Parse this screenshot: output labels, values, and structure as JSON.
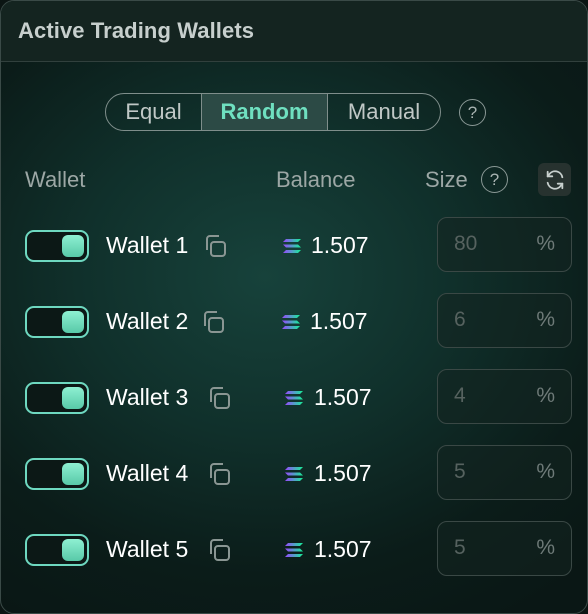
{
  "header": {
    "title": "Active Trading Wallets"
  },
  "mode_selector": {
    "options": [
      "Equal",
      "Random",
      "Manual"
    ],
    "selected": "Random",
    "help_symbol": "?"
  },
  "columns": {
    "wallet": "Wallet",
    "balance": "Balance",
    "size": "Size",
    "size_help_symbol": "?"
  },
  "colors": {
    "accent": "#6fe0c0",
    "toggle_border": "#6ed8c0",
    "text": "#ffffff",
    "muted": "#9ca7a5"
  },
  "wallets": [
    {
      "name": "Wallet 1",
      "enabled": true,
      "balance": "1.507",
      "size": "80",
      "unit": "%"
    },
    {
      "name": "Wallet 2",
      "enabled": true,
      "balance": "1.507",
      "size": "6",
      "unit": "%"
    },
    {
      "name": "Wallet 3",
      "enabled": true,
      "balance": "1.507",
      "size": "4",
      "unit": "%"
    },
    {
      "name": "Wallet 4",
      "enabled": true,
      "balance": "1.507",
      "size": "5",
      "unit": "%"
    },
    {
      "name": "Wallet 5",
      "enabled": true,
      "balance": "1.507",
      "size": "5",
      "unit": "%"
    }
  ],
  "icons": {
    "copy": "copy-icon",
    "balance_token": "solana-icon",
    "refresh": "refresh-icon",
    "help": "help-icon"
  }
}
